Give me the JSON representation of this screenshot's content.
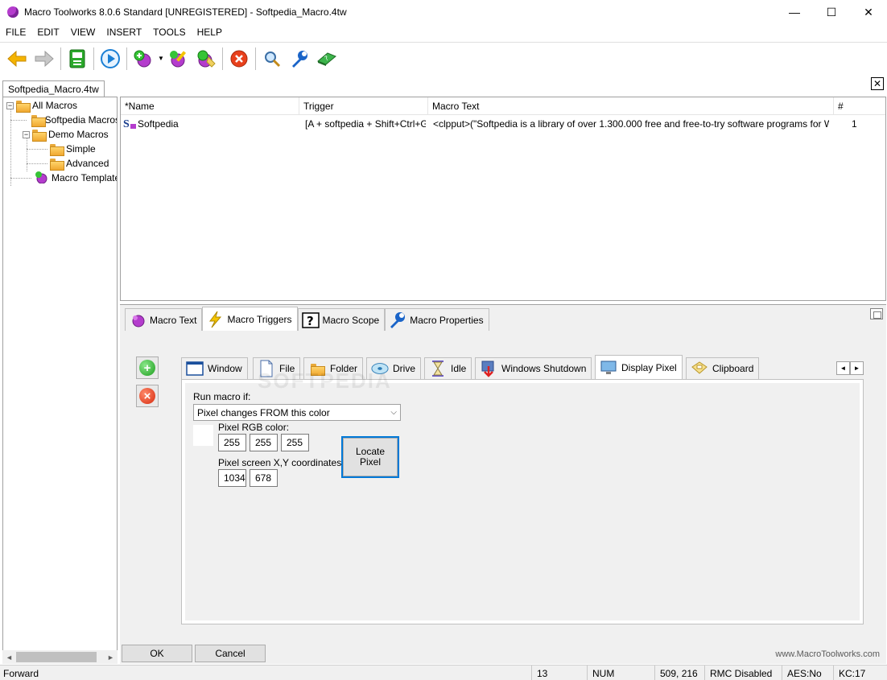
{
  "window": {
    "title": "Macro Toolworks 8.0.6 Standard [UNREGISTERED] - Softpedia_Macro.4tw",
    "minimize": "—",
    "maximize": "☐",
    "close": "✕"
  },
  "menu": [
    "FILE",
    "EDIT",
    "VIEW",
    "INSERT",
    "TOOLS",
    "HELP"
  ],
  "toolbar_icons": [
    "back-arrow-icon",
    "forward-arrow-icon",
    "save-icon",
    "play-icon",
    "add-macro-icon",
    "dropdown-icon",
    "edit-macro-icon",
    "new-macro-icon",
    "delete-icon",
    "search-icon",
    "tools-icon",
    "help-book-icon"
  ],
  "document_tab": {
    "label": "Softpedia_Macro.4tw",
    "close": "✕"
  },
  "tree": {
    "expand_minus": "−",
    "items": [
      {
        "label": "All Macros",
        "icon": "folder-icon"
      },
      {
        "label": "Softpedia Macros",
        "icon": "folder-icon"
      },
      {
        "label": "Demo Macros",
        "icon": "folder-icon"
      },
      {
        "label": "Simple",
        "icon": "folder-icon"
      },
      {
        "label": "Advanced",
        "icon": "folder-icon"
      },
      {
        "label": "Macro Templates",
        "icon": "macro-template-icon"
      }
    ]
  },
  "macro_list": {
    "columns": [
      "*Name",
      "Trigger",
      "Macro Text",
      "#"
    ],
    "rows": [
      {
        "name": "Softpedia",
        "trigger": "[A + softpedia + Shift+Ctrl+G ...",
        "text": "<clpput>(\"Softpedia is a library of over 1.300.000 free and free-to-try software programs for Windows a...",
        "count": "1"
      }
    ]
  },
  "main_tabs": [
    {
      "label": "Macro Text",
      "icon": "macro-text-icon"
    },
    {
      "label": "Macro Triggers",
      "icon": "lightning-icon",
      "active": true
    },
    {
      "label": "Macro Scope",
      "icon": "question-icon"
    },
    {
      "label": "Macro Properties",
      "icon": "wrench-icon"
    }
  ],
  "trigger_tabs": [
    {
      "label": "Window",
      "icon": "window-icon"
    },
    {
      "label": "File",
      "icon": "file-icon"
    },
    {
      "label": "Folder",
      "icon": "folder-icon"
    },
    {
      "label": "Drive",
      "icon": "drive-icon"
    },
    {
      "label": "Idle",
      "icon": "hourglass-icon"
    },
    {
      "label": "Windows Shutdown",
      "icon": "shutdown-icon"
    },
    {
      "label": "Display Pixel",
      "icon": "monitor-icon",
      "active": true
    },
    {
      "label": "Clipboard",
      "icon": "clipboard-icon"
    }
  ],
  "scroll_left": "◄",
  "scroll_right": "►",
  "display_pixel": {
    "run_macro_if_label": "Run macro if:",
    "condition": "Pixel changes FROM this color",
    "dropdown_arrow": "⌵",
    "rgb_label": "Pixel RGB color:",
    "r": "255",
    "g": "255",
    "b": "255",
    "swatch_color": "#ffffff",
    "coords_label": "Pixel screen X,Y coordinates:",
    "x": "1034",
    "y": "678",
    "locate_line1": "Locate",
    "locate_line2": "Pixel"
  },
  "buttons": {
    "ok": "OK",
    "cancel": "Cancel"
  },
  "website": "www.MacroToolworks.com",
  "watermark": "SOFTPEDIA",
  "hscroll": {
    "left": "◄",
    "right": "►"
  },
  "status": {
    "left": "Forward",
    "count": "13",
    "num": "NUM",
    "coords": "509, 216",
    "rmc": "RMC Disabled",
    "aes": "AES:No",
    "kc": "KC:17"
  }
}
